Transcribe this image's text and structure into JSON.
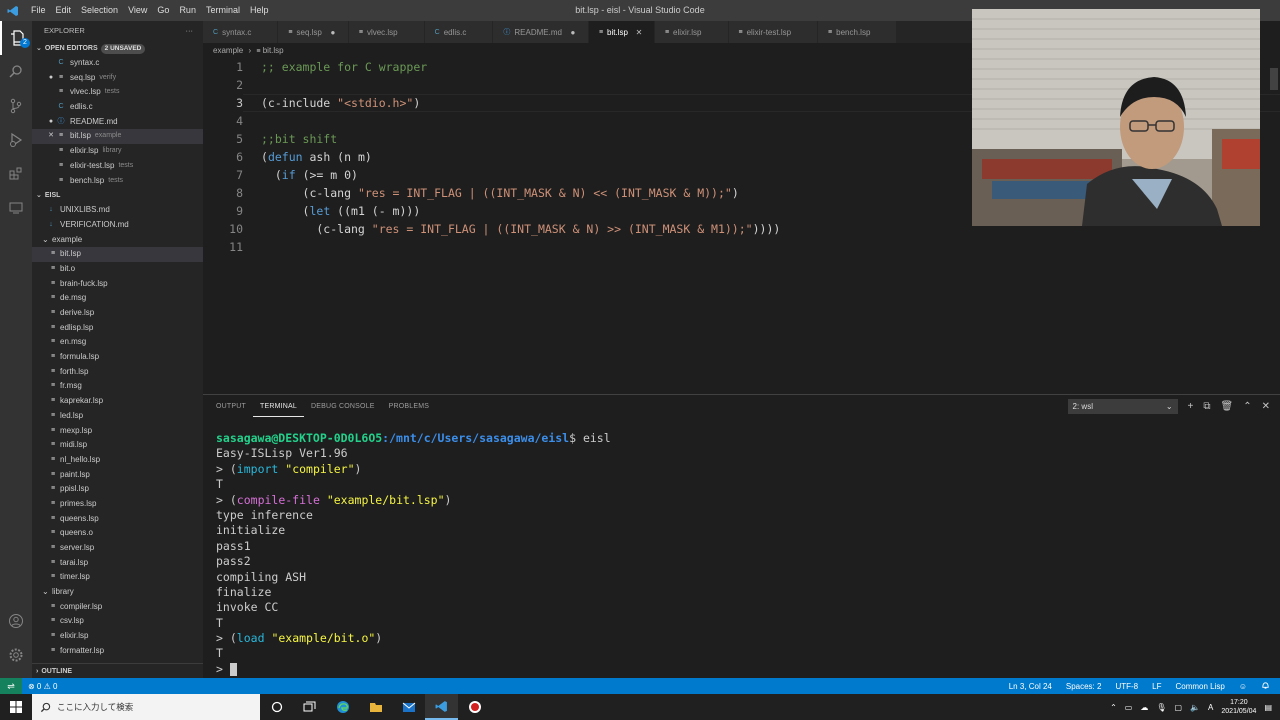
{
  "titlebar": {
    "app_icon": "vscode-icon",
    "menus": [
      "File",
      "Edit",
      "Selection",
      "View",
      "Go",
      "Run",
      "Terminal",
      "Help"
    ],
    "title": "bit.lsp - eisl - Visual Studio Code"
  },
  "activity": {
    "items": [
      "files-icon",
      "search-icon",
      "source-control-icon",
      "run-debug-icon",
      "extensions-icon",
      "remote-explorer-icon"
    ],
    "badge": "2",
    "bottom": [
      "account-icon",
      "settings-gear-icon"
    ]
  },
  "sidebar": {
    "header": "EXPLORER",
    "more": "···",
    "open_editors": {
      "label": "OPEN EDITORS",
      "badge": "2 UNSAVED"
    },
    "open_files": [
      {
        "name": "syntax.c",
        "desc": "",
        "marker": "",
        "icon": "C"
      },
      {
        "name": "seq.lsp",
        "desc": "verify",
        "marker": "●",
        "icon": "≡"
      },
      {
        "name": "vlvec.lsp",
        "desc": "tests",
        "marker": "",
        "icon": "≡"
      },
      {
        "name": "edlis.c",
        "desc": "",
        "marker": "",
        "icon": "C"
      },
      {
        "name": "README.md",
        "desc": "",
        "marker": "●",
        "icon": "ⓘ"
      },
      {
        "name": "bit.lsp",
        "desc": "example",
        "marker": "✕",
        "icon": "≡"
      },
      {
        "name": "elixir.lsp",
        "desc": "library",
        "marker": "",
        "icon": "≡"
      },
      {
        "name": "elixir-test.lsp",
        "desc": "tests",
        "marker": "",
        "icon": "≡"
      },
      {
        "name": "bench.lsp",
        "desc": "tests",
        "marker": "",
        "icon": "≡"
      }
    ],
    "project": "EISL",
    "root_files": [
      {
        "name": "UNIXLIBS.md",
        "icon": "↓"
      },
      {
        "name": "VERIFICATION.md",
        "icon": "↓"
      }
    ],
    "example_folder": "example",
    "example_files": [
      "bit.lsp",
      "bit.o",
      "brain-fuck.lsp",
      "de.msg",
      "derive.lsp",
      "edlisp.lsp",
      "en.msg",
      "formula.lsp",
      "forth.lsp",
      "fr.msg",
      "kaprekar.lsp",
      "led.lsp",
      "mexp.lsp",
      "midi.lsp",
      "nl_hello.lsp",
      "paint.lsp",
      "ppisl.lsp",
      "primes.lsp",
      "queens.lsp",
      "queens.o",
      "server.lsp",
      "tarai.lsp",
      "timer.lsp"
    ],
    "library_folder": "library",
    "library_files": [
      "compiler.lsp",
      "csv.lsp",
      "elixir.lsp",
      "formatter.lsp"
    ],
    "outline": "OUTLINE"
  },
  "tabs": [
    {
      "label": "syntax.c",
      "icon": "C",
      "close": "",
      "active": false
    },
    {
      "label": "seq.lsp",
      "icon": "≡",
      "close": "●",
      "active": false
    },
    {
      "label": "vlvec.lsp",
      "icon": "≡",
      "close": "",
      "active": false
    },
    {
      "label": "edlis.c",
      "icon": "C",
      "close": "",
      "active": false
    },
    {
      "label": "README.md",
      "icon": "ⓘ",
      "close": "●",
      "active": false
    },
    {
      "label": "bit.lsp",
      "icon": "≡",
      "close": "✕",
      "active": true
    },
    {
      "label": "elixir.lsp",
      "icon": "≡",
      "close": "",
      "active": false
    },
    {
      "label": "elixir-test.lsp",
      "icon": "≡",
      "close": "",
      "active": false
    },
    {
      "label": "bench.lsp",
      "icon": "≡",
      "close": "",
      "active": false
    }
  ],
  "breadcrumb": {
    "folder": "example",
    "sep": "›",
    "file": "bit.lsp"
  },
  "editor": {
    "current_line": 3,
    "lines": [
      {
        "n": "1",
        "t": ";; example for C wrapper"
      },
      {
        "n": "2",
        "t": ""
      },
      {
        "n": "3",
        "t": "(c-include \"<stdio.h>\")"
      },
      {
        "n": "4",
        "t": ""
      },
      {
        "n": "5",
        "t": ";;bit shift"
      },
      {
        "n": "6",
        "t": "(defun ash (n m)"
      },
      {
        "n": "7",
        "t": "  (if (>= m 0)"
      },
      {
        "n": "8",
        "t": "      (c-lang \"res = INT_FLAG | ((INT_MASK & N) << (INT_MASK & M));\")"
      },
      {
        "n": "9",
        "t": "      (let ((m1 (- m)))"
      },
      {
        "n": "10",
        "t": "        (c-lang \"res = INT_FLAG | ((INT_MASK & N) >> (INT_MASK & M1));\"))))"
      },
      {
        "n": "11",
        "t": ""
      }
    ]
  },
  "panel": {
    "tabs": [
      "OUTPUT",
      "TERMINAL",
      "DEBUG CONSOLE",
      "PROBLEMS"
    ],
    "active_tab": "TERMINAL",
    "terminal_select": "2: wsl",
    "tools": [
      "+",
      "⧉",
      "🗑",
      "⌃",
      "✕"
    ],
    "prompt_user": "sasagawa@DESKTOP-0D0L6O5",
    "prompt_path": ":/mnt/c/Users/sasagawa/eisl",
    "prompt_cmd": "$ eisl",
    "version": "Easy-ISLisp Ver1.96",
    "cmd1_kw": "import",
    "cmd1_arg": "\"compiler\"",
    "r1": "T",
    "cmd2_kw": "compile-file",
    "cmd2_arg": "\"example/bit.lsp\"",
    "out": [
      "type inference",
      "initialize",
      "pass1",
      "pass2",
      "compiling ASH",
      "finalize",
      "invoke CC"
    ],
    "r2": "T",
    "cmd3_kw": "load",
    "cmd3_arg": "\"example/bit.o\"",
    "r3": "T",
    "prompt": "> "
  },
  "status": {
    "remote": "⇌",
    "problems": "⊗ 0 ⚠ 0",
    "position": "Ln 3, Col 24",
    "spaces": "Spaces: 2",
    "encoding": "UTF-8",
    "eol": "LF",
    "language": "Common Lisp",
    "feedback": "☺",
    "bell": "🔔"
  },
  "taskbar": {
    "search_placeholder": "ここに入力して検索",
    "time": "17:20",
    "date": "2021/05/04",
    "ime": "A"
  }
}
